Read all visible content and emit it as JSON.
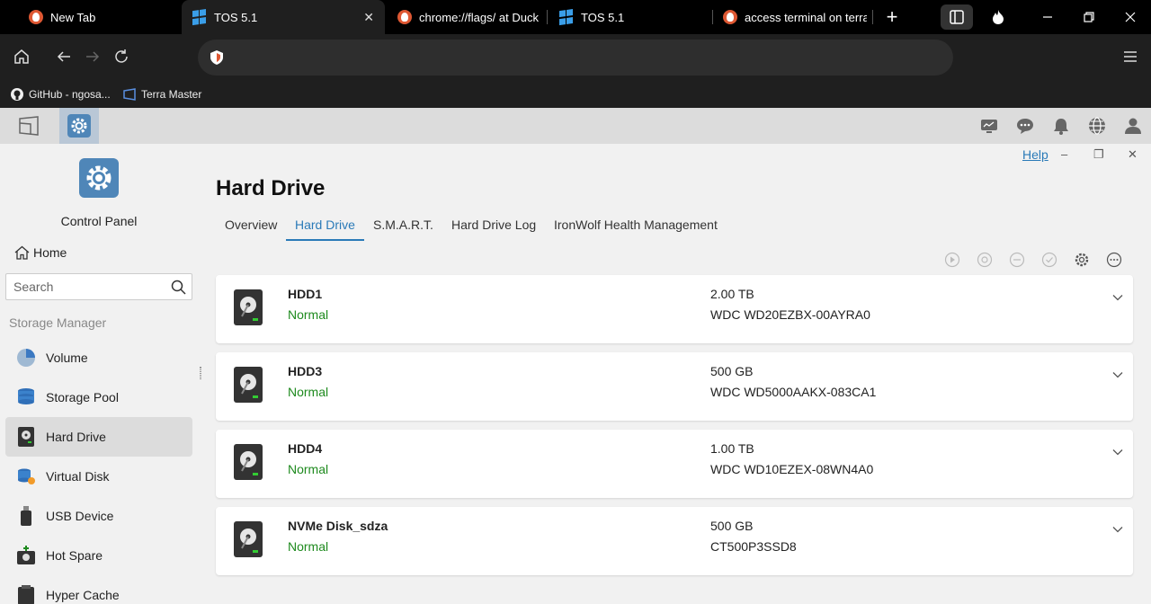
{
  "browser": {
    "tabs": [
      {
        "title": "New Tab",
        "favicon": "duckduckgo-icon"
      },
      {
        "title": "TOS 5.1",
        "favicon": "windows-icon",
        "active": true
      },
      {
        "title": "chrome://flags/ at Duck",
        "favicon": "duckduckgo-icon"
      },
      {
        "title": "TOS 5.1",
        "favicon": "windows-icon"
      },
      {
        "title": "access terminal on terra",
        "favicon": "duckduckgo-icon"
      }
    ],
    "new_tab": "+",
    "close": "✕",
    "address_value": "",
    "bookmarks": [
      {
        "label": "GitHub - ngosa...",
        "icon": "github-icon"
      },
      {
        "label": "Terra Master",
        "icon": "terramaster-icon"
      }
    ]
  },
  "window": {
    "help_label": "Help",
    "minimize": "–",
    "restore": "❐",
    "close": "✕"
  },
  "sidebar": {
    "app_title": "Control Panel",
    "home_label": "Home",
    "search_placeholder": "Search",
    "section": "Storage Manager",
    "items": [
      {
        "label": "Volume",
        "icon": "volume-icon"
      },
      {
        "label": "Storage Pool",
        "icon": "storage-pool-icon"
      },
      {
        "label": "Hard Drive",
        "icon": "hard-drive-icon",
        "active": true
      },
      {
        "label": "Virtual Disk",
        "icon": "virtual-disk-icon"
      },
      {
        "label": "USB Device",
        "icon": "usb-device-icon"
      },
      {
        "label": "Hot Spare",
        "icon": "hot-spare-icon"
      },
      {
        "label": "Hyper Cache",
        "icon": "hyper-cache-icon"
      }
    ]
  },
  "main": {
    "title": "Hard Drive",
    "tabs": [
      {
        "label": "Overview"
      },
      {
        "label": "Hard Drive",
        "active": true
      },
      {
        "label": "S.M.A.R.T."
      },
      {
        "label": "Hard Drive Log"
      },
      {
        "label": "IronWolf Health Management"
      }
    ],
    "disks": [
      {
        "name": "HDD1",
        "status": "Normal",
        "size": "2.00 TB",
        "model": "WDC WD20EZBX-00AYRA0"
      },
      {
        "name": "HDD3",
        "status": "Normal",
        "size": "500 GB",
        "model": "WDC WD5000AAKX-083CA1"
      },
      {
        "name": "HDD4",
        "status": "Normal",
        "size": "1.00 TB",
        "model": "WDC WD10EZEX-08WN4A0"
      },
      {
        "name": "NVMe Disk_sdza",
        "status": "Normal",
        "size": "500 GB",
        "model": "CT500P3SSD8"
      }
    ]
  },
  "colors": {
    "accent": "#2a7ab8",
    "status_normal": "#1e8a1e",
    "browser_bg": "#1f1f1f"
  }
}
